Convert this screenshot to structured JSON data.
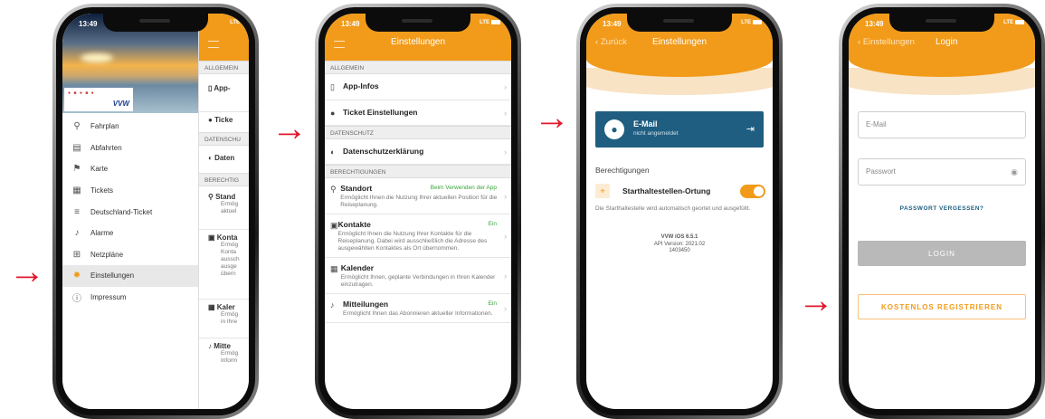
{
  "status": {
    "time": "13:49",
    "network": "LTE"
  },
  "phone1": {
    "logo_text": "VVW",
    "menu": [
      {
        "label": "Fahrplan",
        "icon": "⚲"
      },
      {
        "label": "Abfahrten",
        "icon": "▤"
      },
      {
        "label": "Karte",
        "icon": "⚑"
      },
      {
        "label": "Tickets",
        "icon": "▦"
      },
      {
        "label": "Deutschland-Ticket",
        "icon": "≡"
      },
      {
        "label": "Alarme",
        "icon": "♪"
      },
      {
        "label": "Netzpläne",
        "icon": "⊞"
      },
      {
        "label": "Einstellungen",
        "icon": "✹"
      },
      {
        "label": "Impressum",
        "icon": "ⓘ"
      }
    ],
    "peek": {
      "sec_allgemein": "ALLGEMEIN",
      "app": "App-",
      "ticket": "Ticke",
      "sec_datenschutz": "DATENSCHU",
      "daten": "Daten",
      "sec_berechtigungen": "BERECHTIG",
      "standort": "Stand",
      "standort_d1": "Ermög",
      "standort_d2": "aktuel",
      "kontakte": "Konta",
      "kontakte_d": [
        "Ermög",
        "Konta",
        "aussch",
        "ausge",
        "übern"
      ],
      "kalender": "Kaler",
      "kalender_d": [
        "Ermög",
        "in Ihre"
      ],
      "mitteilungen": "Mitte",
      "mitteilungen_d": [
        "Ermög",
        "Inform"
      ]
    }
  },
  "phone2": {
    "title": "Einstellungen",
    "sec_allgemein": "ALLGEMEIN",
    "app_infos": "App-Infos",
    "ticket_einstellungen": "Ticket Einstellungen",
    "sec_datenschutz": "DATENSCHUTZ",
    "datenschutz": "Datenschutzerklärung",
    "sec_berechtigungen": "BERECHTIGUNGEN",
    "permissions": [
      {
        "title": "Standort",
        "status": "Beim Verwenden der App",
        "desc": "Ermöglicht Ihnen die Nutzung Ihrer aktuellen Position für die Reiseplanung.",
        "icon": "⚲"
      },
      {
        "title": "Kontakte",
        "status": "Ein",
        "desc": "Ermöglicht Ihnen die Nutzung Ihrer Kontakte für die Reiseplanung. Dabei wird ausschließlich die Adresse des ausgewählten Kontaktes als Ort übernommen.",
        "icon": "▣"
      },
      {
        "title": "Kalender",
        "status": "",
        "desc": "Ermöglicht Ihnen, geplante Verbindungen in Ihren Kalender einzutragen.",
        "icon": "▦"
      },
      {
        "title": "Mitteilungen",
        "status": "Ein",
        "desc": "Ermöglicht Ihnen das Abonnieren aktueller Informationen.",
        "icon": "♪"
      }
    ]
  },
  "phone3": {
    "back": "Zurück",
    "title": "Einstellungen",
    "email_title": "E-Mail",
    "email_sub": "nicht angemeldet",
    "perm_heading": "Berechtigungen",
    "toggle_label": "Starthaltestellen-Ortung",
    "toggle_on": true,
    "toggle_desc": "Die Starthaltestelle wird automatisch geortet und ausgefüllt.",
    "version": "VVW iOS 6.5.1",
    "api": "API Version: 2021.02",
    "build": "1403450"
  },
  "phone4": {
    "back": "Einstellungen",
    "title": "Login",
    "email_placeholder": "E-Mail",
    "password_placeholder": "Passwort",
    "forgot": "PASSWORT VERGESSEN?",
    "login": "LOGIN",
    "register": "KOSTENLOS REGISTRIEREN"
  },
  "colors": {
    "orange": "#f29b1a",
    "blue": "#1f5e80",
    "arrow": "#e3172d"
  },
  "arrows": "→"
}
